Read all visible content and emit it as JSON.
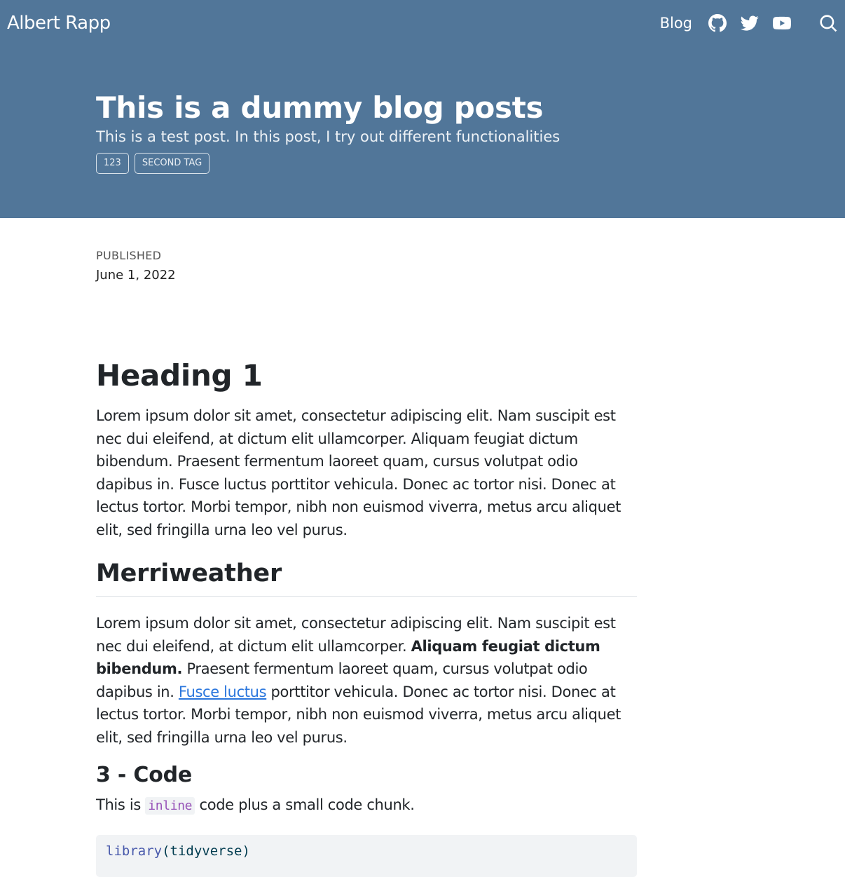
{
  "nav": {
    "brand": "Albert Rapp",
    "blog_label": "Blog",
    "icons": [
      "github-icon",
      "twitter-icon",
      "youtube-icon",
      "search-icon"
    ]
  },
  "banner": {
    "title": "This is a dummy blog posts",
    "subtitle": "This is a test post. In this post, I try out different functionalities",
    "tags": [
      "123",
      "SECOND TAG"
    ]
  },
  "meta": {
    "label": "PUBLISHED",
    "date": "June 1, 2022"
  },
  "content": {
    "heading1": "Heading 1",
    "para1": "Lorem ipsum dolor sit amet, consectetur adipiscing elit. Nam suscipit est nec dui eleifend, at dictum elit ullamcorper. Aliquam feugiat dictum bibendum. Praesent fermentum laoreet quam, cursus volutpat odio dapibus in. Fusce luctus porttitor vehicula. Donec ac tortor nisi. Donec at lectus tortor. Morbi tempor, nibh non euismod viverra, metus arcu aliquet elit, sed fringilla urna leo vel purus.",
    "heading2": "Merriweather",
    "para2": {
      "part1": "Lorem ipsum dolor sit amet, consectetur adipiscing elit. Nam suscipit est nec dui eleifend, at dictum elit ullamcorper. ",
      "bold": "Aliquam feugiat dictum bibendum.",
      "part2": " Praesent fermentum laoreet quam, cursus volutpat odio dapibus in. ",
      "link": "Fusce luctus",
      "part3": " porttitor vehicula. Donec ac tortor nisi. Donec at lectus tortor. Morbi tempor, nibh non euismod viverra, metus arcu aliquet elit, sed fringilla urna leo vel purus."
    },
    "heading3": "3 - Code",
    "para3": {
      "before": "This is ",
      "code": "inline",
      "after": " code plus a small code chunk."
    },
    "code_block": {
      "fn": "library",
      "open": "(",
      "arg": "tidyverse",
      "close": ")"
    }
  }
}
